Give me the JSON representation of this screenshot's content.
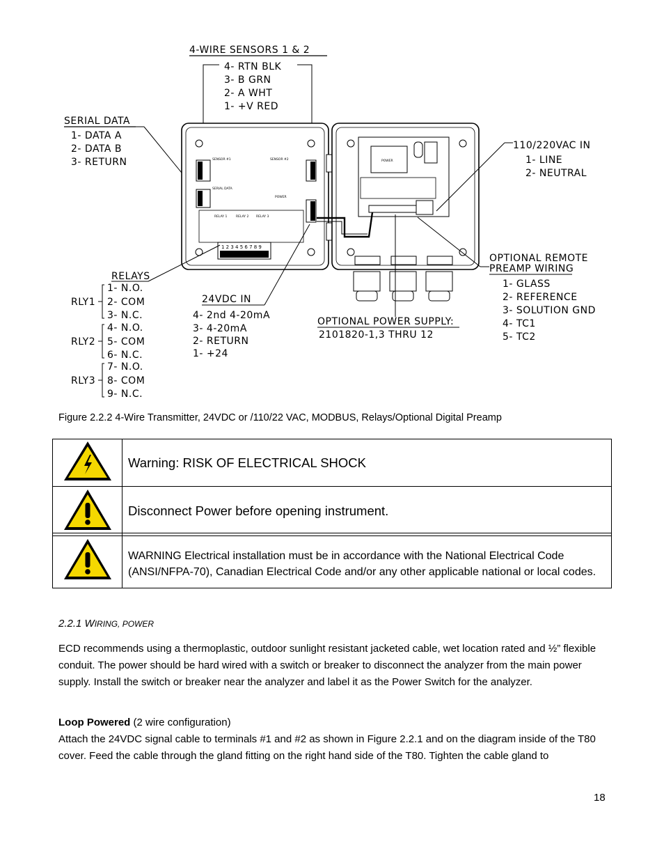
{
  "diagram": {
    "four_wire_sensors": {
      "title": "4-WIRE SENSORS 1 & 2",
      "lines": [
        "4- RTN BLK",
        "3- B GRN",
        "2- A WHT",
        "1- +V RED"
      ]
    },
    "serial_data": {
      "title": "SERIAL DATA",
      "lines": [
        "1- DATA A",
        "2- DATA B",
        "3- RETURN"
      ]
    },
    "vac_in": {
      "title": "110/220VAC IN",
      "lines": [
        "1- LINE",
        "2- NEUTRAL"
      ]
    },
    "relays": {
      "title": "RELAYS",
      "groups": [
        {
          "name": "RLY1",
          "lines": [
            "1- N.O.",
            "2- COM",
            "3- N.C."
          ]
        },
        {
          "name": "RLY2",
          "lines": [
            "4- N.O.",
            "5- COM",
            "6- N.C."
          ]
        },
        {
          "name": "RLY3",
          "lines": [
            "7- N.O.",
            "8- COM",
            "9- N.C."
          ]
        }
      ]
    },
    "vdc_in": {
      "title": "24VDC IN",
      "lines": [
        "4- 2nd 4-20mA",
        "3- 4-20mA",
        "2- RETURN",
        "1- +24"
      ]
    },
    "optional_power_supply": {
      "title": "OPTIONAL POWER SUPPLY:",
      "part": "2101820-1,3 THRU 12"
    },
    "optional_preamp": {
      "title_line1": "OPTIONAL REMOTE",
      "title_line2": "PREAMP WIRING",
      "lines": [
        "1- GLASS",
        "2- REFERENCE",
        "3- SOLUTION GND",
        "4- TC1",
        "5- TC2"
      ]
    },
    "board_labels": {
      "sensor1": "SENSOR #1",
      "sensor2": "SENSOR #2",
      "serial": "SERIAL DATA",
      "power": "POWER",
      "relay1": "RELAY 1",
      "relay2": "RELAY 2",
      "relay3": "RELAY 3",
      "relay_terminals": "1 2 3 4 5 6 7 8 9",
      "psu": "POWER"
    }
  },
  "caption": "Figure 2.2.2 4-Wire Transmitter, 24VDC or /110/22 VAC, MODBUS, Relays/Optional Digital Preamp",
  "warnings": [
    {
      "icon": "electrical-shock-warning",
      "text": "Warning: RISK OF ELECTRICAL SHOCK"
    },
    {
      "icon": "exclamation-warning",
      "text": "Disconnect Power before opening instrument."
    },
    {
      "icon": "exclamation-warning",
      "text": "WARNING  Electrical installation must be in accordance with the National Electrical Code (ANSI/NFPA-70), Canadian Electrical Code and/or any other applicable national or local codes."
    }
  ],
  "section": {
    "number": "2.2.1",
    "title_first": "W",
    "title_rest": "IRING, POWER",
    "paragraph1": "ECD recommends using a thermoplastic, outdoor sunlight resistant jacketed cable, wet location rated and ½” flexible conduit. The power should be hard wired with a switch or breaker to disconnect the analyzer from the main power supply. Install the switch or breaker near the analyzer and label it as the Power Switch for the analyzer.",
    "subhead_bold": "Loop Powered",
    "subhead_rest": " (2 wire configuration)",
    "paragraph2": "Attach the 24VDC signal cable to terminals #1 and #2 as shown in Figure 2.2.1 and on the diagram inside of the T80 cover. Feed the cable through the gland fitting on the right hand side of the T80. Tighten the cable gland to"
  },
  "page_number": "18"
}
